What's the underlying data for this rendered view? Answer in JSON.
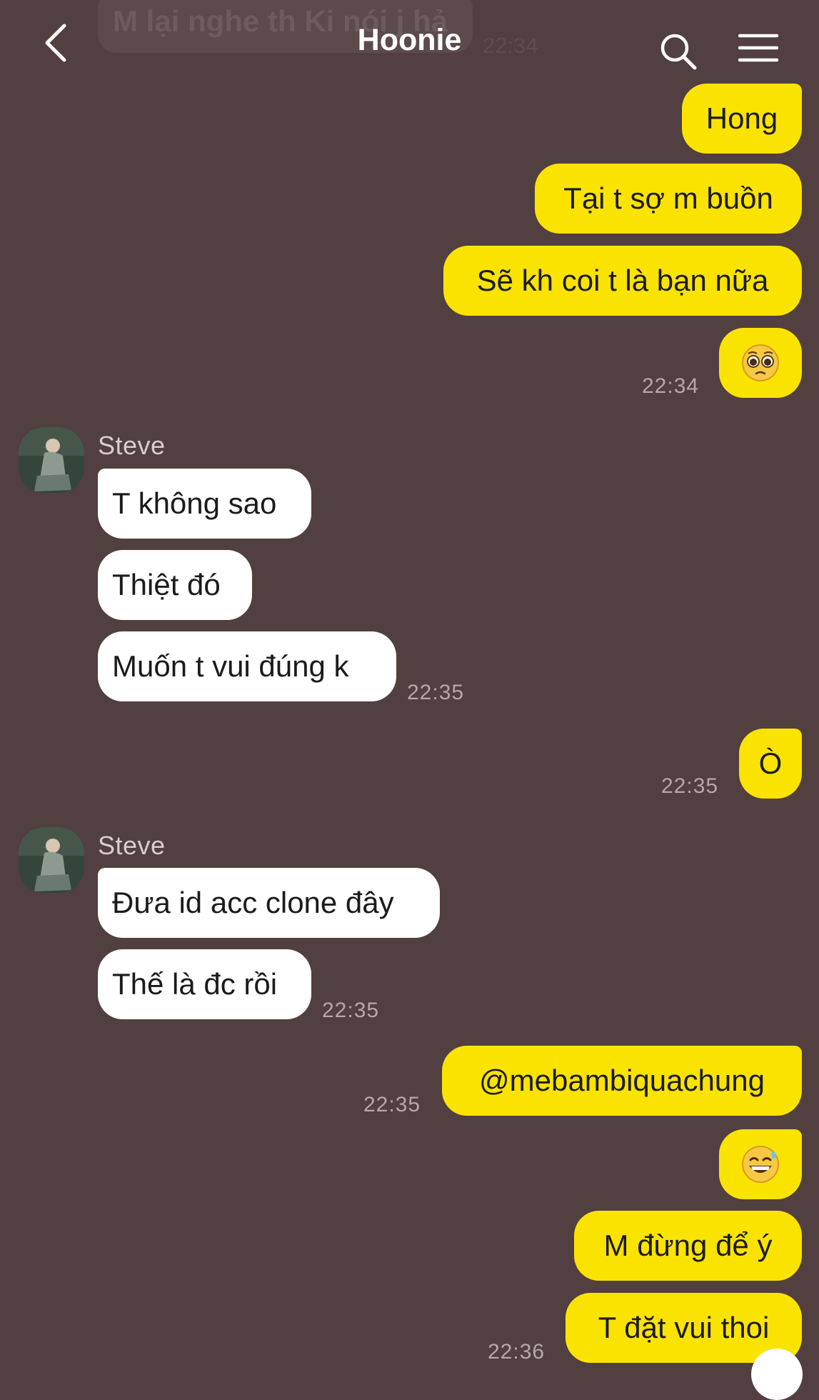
{
  "header": {
    "title": "Hoonie",
    "back_icon": "chevron-left-icon",
    "search_icon": "search-icon",
    "menu_icon": "hamburger-menu-icon"
  },
  "ghost": {
    "text": "M lại nghe th Ki nói j hả",
    "time": "22:34"
  },
  "messages": [
    {
      "side": "out",
      "text": "Hong"
    },
    {
      "side": "out",
      "text": "Tại t sợ m buồn"
    },
    {
      "side": "out",
      "text": "Sẽ kh coi t là bạn nữa"
    },
    {
      "side": "out",
      "emoji": "pleading-face-emoji",
      "time": "22:34"
    },
    {
      "side": "in",
      "sender": "Steve",
      "text": "T không sao"
    },
    {
      "side": "in",
      "text": "Thiệt đó"
    },
    {
      "side": "in",
      "text": "Muốn t vui đúng k",
      "time": "22:35"
    },
    {
      "side": "out",
      "text": "Ò",
      "time": "22:35"
    },
    {
      "side": "in",
      "sender": "Steve",
      "text": "Đưa id acc clone đây"
    },
    {
      "side": "in",
      "text": "Thế là đc rồi",
      "time": "22:35"
    },
    {
      "side": "out",
      "text": "@mebambiquachung",
      "time": "22:35"
    },
    {
      "side": "out",
      "emoji": "grinning-sweat-emoji"
    },
    {
      "side": "out",
      "text": "M đừng để ý"
    },
    {
      "side": "out",
      "text": "T đặt vui thoi",
      "time": "22:36"
    }
  ],
  "colors": {
    "background": "#523f40",
    "outgoing_bubble": "#fbe300",
    "incoming_bubble": "#ffffff",
    "timestamp": "#b5a8a8"
  }
}
